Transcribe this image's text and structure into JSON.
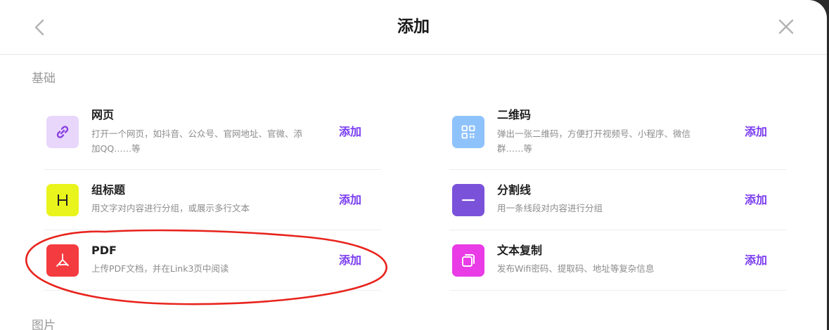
{
  "header": {
    "title": "添加"
  },
  "sections": {
    "basic_label": "基础",
    "next_label": "图片"
  },
  "items": {
    "webpage": {
      "name": "网页",
      "desc": "打开一个网页，如抖音、公众号、官网地址、官微、添加QQ……等",
      "add": "添加",
      "icon": "link-icon",
      "color": "#e8d6fb"
    },
    "qrcode": {
      "name": "二维码",
      "desc": "弹出一张二维码，方便打开视频号、小程序、微信群……等",
      "add": "添加",
      "icon": "qr-code-icon",
      "color": "#8ec2fb"
    },
    "group_title": {
      "name": "组标题",
      "desc": "用文字对内容进行分组，或展示多行文本",
      "add": "添加",
      "icon": "heading-icon",
      "color": "#e9f41c"
    },
    "divider": {
      "name": "分割线",
      "desc": "用一条线段对内容进行分组",
      "add": "添加",
      "icon": "divider-icon",
      "color": "#7a52d9"
    },
    "pdf": {
      "name": "PDF",
      "desc": "上传PDF文档，并在Link3页中阅读",
      "add": "添加",
      "icon": "pdf-icon",
      "color": "#f43b3f"
    },
    "text_copy": {
      "name": "文本复制",
      "desc": "发布Wifi密码、提取码、地址等复杂信息",
      "add": "添加",
      "icon": "copy-icon",
      "color": "#e93be6"
    }
  },
  "colors": {
    "accent": "#7a3cf0",
    "annotation": "#e8231c"
  }
}
